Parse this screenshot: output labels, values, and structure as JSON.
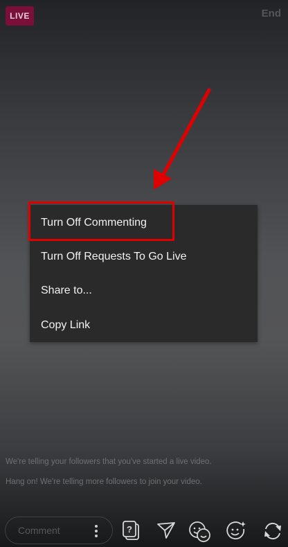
{
  "header": {
    "live_badge": "LIVE",
    "end_label": "End"
  },
  "menu": {
    "items": [
      {
        "label": "Turn Off Commenting",
        "highlighted": true
      },
      {
        "label": "Turn Off Requests To Go Live"
      },
      {
        "label": "Share to..."
      },
      {
        "label": "Copy Link"
      }
    ]
  },
  "status": {
    "line1": "We're telling your followers that you've started a live video.",
    "line2": "Hang on! We're telling more followers to join your video."
  },
  "comment": {
    "placeholder": "Comment"
  },
  "toolbar": {
    "icons": [
      "question-sticker-icon",
      "send-icon",
      "guests-icon",
      "face-effects-icon",
      "switch-camera-icon"
    ]
  },
  "colors": {
    "annotation_red": "#e00000",
    "live_badge_bg": "#7a0f3a",
    "menu_bg": "#2a2a2b"
  }
}
